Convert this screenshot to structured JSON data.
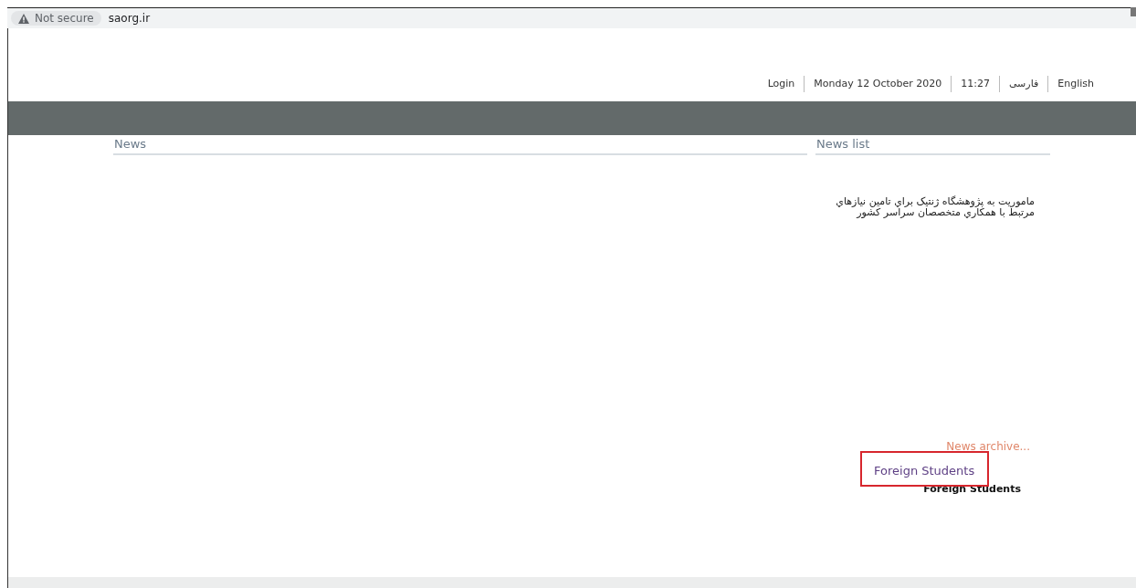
{
  "address_bar": {
    "security_label": "Not secure",
    "url": "saorg.ir"
  },
  "header": {
    "links": [
      {
        "label": "Login"
      },
      {
        "label": "Monday 12 October 2020"
      },
      {
        "label": "11:27"
      },
      {
        "label": "فارسی"
      },
      {
        "label": "English"
      }
    ]
  },
  "main": {
    "title": "News"
  },
  "sidebar": {
    "title": "News list",
    "news": [
      {
        "text": "ماموريت به پژوهشگاه ژنتيک براي تامين نيازهاي مرتبط با همكاري متخصصان سراسر كشور"
      }
    ],
    "archive_link": "News archive...",
    "section_link": "Foreign Students",
    "section_title": "Foreign Students"
  }
}
